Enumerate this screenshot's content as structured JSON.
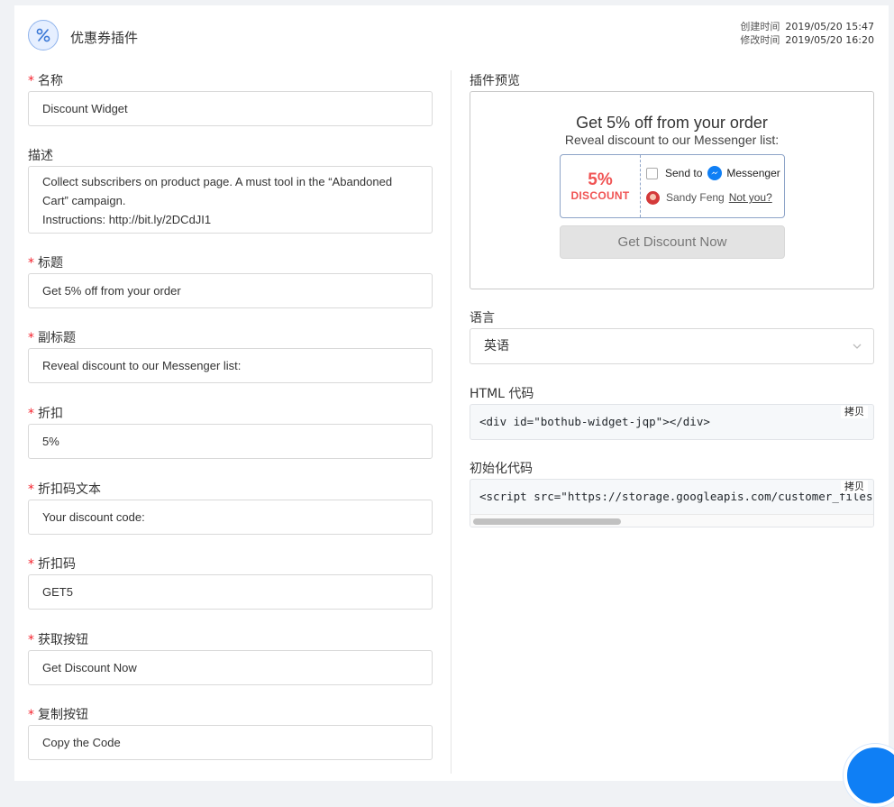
{
  "header": {
    "icon": "percent-icon",
    "title": "优惠券插件",
    "created_label": "创建时间",
    "created_value": "2019/05/20 15:47",
    "modified_label": "修改时间",
    "modified_value": "2019/05/20 16:20"
  },
  "form": {
    "name": {
      "label": "名称",
      "value": "Discount Widget"
    },
    "description": {
      "label": "描述",
      "line1": "Collect subscribers on product page. A must tool in the “Abandoned",
      "line2": "Cart” campaign.",
      "line3": "Instructions: http://bit.ly/2DCdJI1"
    },
    "title": {
      "label": "标题",
      "value": "Get 5% off from your order"
    },
    "subtitle": {
      "label": "副标题",
      "value": "Reveal discount to our Messenger list:"
    },
    "discount": {
      "label": "折扣",
      "value": "5%"
    },
    "discount_code_text": {
      "label": "折扣码文本",
      "value": "Your discount code:"
    },
    "discount_code": {
      "label": "折扣码",
      "value": "GET5"
    },
    "get_button": {
      "label": "获取按钮",
      "value": "Get Discount Now"
    },
    "copy_button": {
      "label": "复制按钮",
      "value": "Copy the Code"
    }
  },
  "preview": {
    "label": "插件预览",
    "title": "Get 5% off from your order",
    "subtitle": "Reveal discount to our Messenger list:",
    "percent": "5%",
    "discount_word": "DISCOUNT",
    "send_to": "Send to",
    "messenger": "Messenger",
    "user_name": "Sandy Feng",
    "not_you": "Not you?",
    "button": "Get Discount Now"
  },
  "language": {
    "label": "语言",
    "value": "英语"
  },
  "html_code": {
    "label": "HTML 代码",
    "copy": "拷贝",
    "code": "<div id=\"bothub-widget-jqp\"></div>"
  },
  "init_code": {
    "label": "初始化代码",
    "copy": "拷贝",
    "code": "<script src=\"https://storage.googleapis.com/customer_files"
  },
  "colors": {
    "accent": "#0f7ff5",
    "required": "#f5222d",
    "discount": "#f05454"
  }
}
